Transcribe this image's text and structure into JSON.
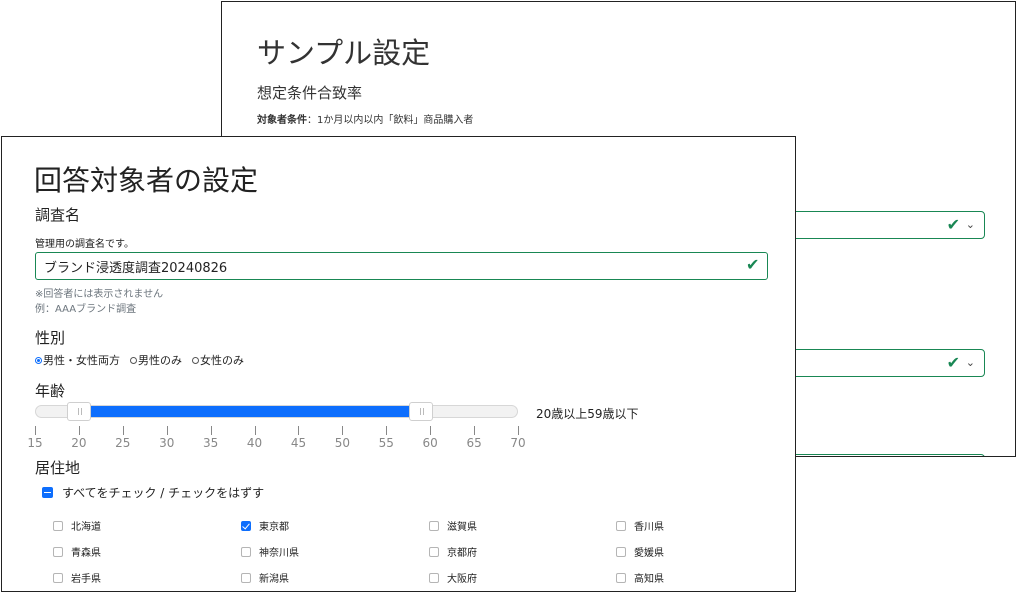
{
  "back": {
    "title": "サンプル設定",
    "subtitle": "想定条件合致率",
    "condition_label": "対象者条件",
    "condition_text": "：1か月以内以内「飲料」商品購入者",
    "valid_icon": "check-icon",
    "chevron_icon": "chevron-down-icon"
  },
  "front": {
    "title": "回答対象者の設定",
    "survey_name": {
      "label": "調査名",
      "help": "管理用の調査名です。",
      "value": "ブランド浸透度調査20240826",
      "note1": "※回答者には表示されません",
      "note2": "例：AAAブランド調査"
    },
    "gender": {
      "label": "性別",
      "options": [
        {
          "label": "男性・女性両方",
          "selected": true
        },
        {
          "label": "男性のみ",
          "selected": false
        },
        {
          "label": "女性のみ",
          "selected": false
        }
      ]
    },
    "age": {
      "label": "年齢",
      "min": 15,
      "max": 70,
      "from": 20,
      "to": 59,
      "value_text": "20歳以上59歳以下",
      "ticks": [
        "15",
        "20",
        "25",
        "30",
        "35",
        "40",
        "45",
        "50",
        "55",
        "60",
        "65",
        "70"
      ]
    },
    "residence": {
      "label": "居住地",
      "check_all_label": "すべてをチェック / チェックをはずす",
      "columns": [
        [
          {
            "label": "北海道",
            "checked": false
          },
          {
            "label": "青森県",
            "checked": false
          },
          {
            "label": "岩手県",
            "checked": false
          }
        ],
        [
          {
            "label": "東京都",
            "checked": true
          },
          {
            "label": "神奈川県",
            "checked": false
          },
          {
            "label": "新潟県",
            "checked": false
          }
        ],
        [
          {
            "label": "滋賀県",
            "checked": false
          },
          {
            "label": "京都府",
            "checked": false
          },
          {
            "label": "大阪府",
            "checked": false
          }
        ],
        [
          {
            "label": "香川県",
            "checked": false
          },
          {
            "label": "愛媛県",
            "checked": false
          },
          {
            "label": "高知県",
            "checked": false
          }
        ]
      ]
    }
  },
  "colors": {
    "accent": "#0d6efd",
    "valid": "#198754"
  }
}
